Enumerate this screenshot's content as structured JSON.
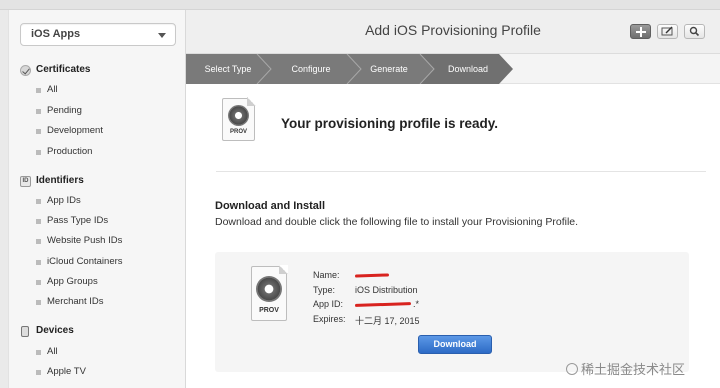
{
  "app_selector": {
    "label": "iOS Apps"
  },
  "sidebar": {
    "sections": [
      {
        "title": "Certificates",
        "icon": "certificate-check-icon",
        "items": [
          "All",
          "Pending",
          "Development",
          "Production"
        ]
      },
      {
        "title": "Identifiers",
        "icon": "id-badge-icon",
        "items": [
          "App IDs",
          "Pass Type IDs",
          "Website Push IDs",
          "iCloud Containers",
          "App Groups",
          "Merchant IDs"
        ]
      },
      {
        "title": "Devices",
        "icon": "device-phone-icon",
        "items": [
          "All",
          "Apple TV"
        ]
      }
    ]
  },
  "header": {
    "title": "Add iOS Provisioning Profile"
  },
  "toolbar": {
    "buttons": [
      "add-icon",
      "edit-icon",
      "search-icon"
    ]
  },
  "wizard": {
    "steps": [
      "Select Type",
      "Configure",
      "Generate",
      "Download"
    ],
    "current_index": 3
  },
  "ready": {
    "message": "Your provisioning profile is ready.",
    "icon_label": "PROV"
  },
  "download_section": {
    "heading": "Download and Install",
    "description": "Download and double click the following file to install your Provisioning Profile.",
    "file_icon_label": "PROV",
    "fields": [
      {
        "key": "Name:",
        "value": ""
      },
      {
        "key": "Type:",
        "value": "iOS Distribution"
      },
      {
        "key": "App ID:",
        "value": ".*"
      },
      {
        "key": "Expires:",
        "value": "十二月 17, 2015"
      }
    ],
    "button_label": "Download"
  },
  "watermark": {
    "text": "稀土掘金技术社区"
  },
  "colors": {
    "accent_blue": "#2d6bc6",
    "step_dark": "#6f6f6f",
    "step_light": "#959595",
    "redaction": "#d8231f"
  }
}
